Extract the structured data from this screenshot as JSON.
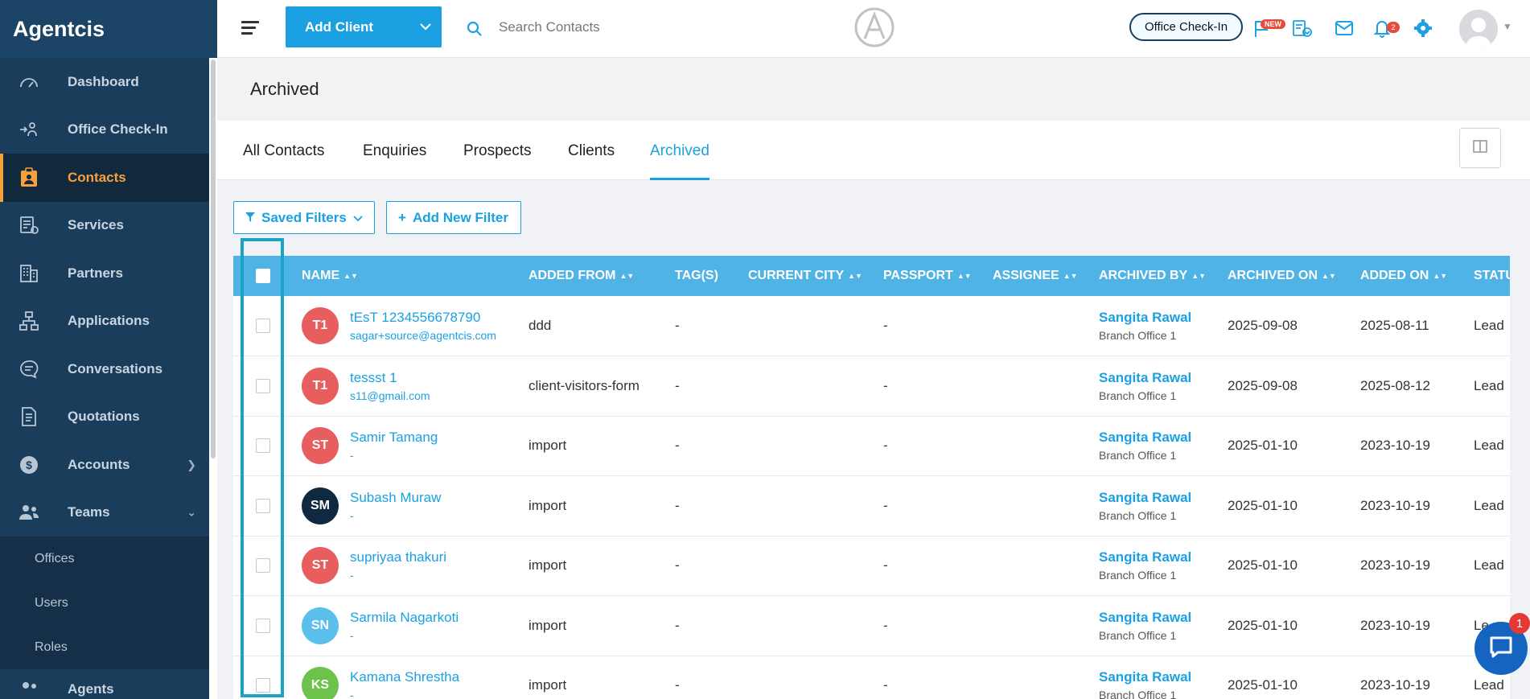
{
  "app": {
    "brand": "Agentcis"
  },
  "sidebar": {
    "items": [
      {
        "label": "Dashboard",
        "icon": "gauge-icon"
      },
      {
        "label": "Office Check-In",
        "icon": "checkin-icon"
      },
      {
        "label": "Contacts",
        "icon": "contact-card-icon",
        "active": true
      },
      {
        "label": "Services",
        "icon": "services-icon"
      },
      {
        "label": "Partners",
        "icon": "building-icon"
      },
      {
        "label": "Applications",
        "icon": "flow-icon"
      },
      {
        "label": "Conversations",
        "icon": "chat-icon"
      },
      {
        "label": "Quotations",
        "icon": "document-icon"
      },
      {
        "label": "Accounts",
        "icon": "dollar-icon"
      },
      {
        "label": "Teams",
        "icon": "team-icon"
      }
    ],
    "teams_sub": [
      "Offices",
      "Users",
      "Roles"
    ],
    "partial": "Agents"
  },
  "topbar": {
    "add_client": "Add Client",
    "search_placeholder": "Search Contacts",
    "office_checkin": "Office Check-In",
    "new_badge": "NEW",
    "notification_count": "2"
  },
  "page": {
    "title": "Archived"
  },
  "tabs": [
    "All Contacts",
    "Enquiries",
    "Prospects",
    "Clients",
    "Archived"
  ],
  "filters": {
    "saved": "Saved Filters",
    "add_new": "Add New Filter"
  },
  "table": {
    "columns": [
      "NAME",
      "ADDED FROM",
      "TAG(S)",
      "CURRENT CITY",
      "PASSPORT",
      "ASSIGNEE",
      "ARCHIVED BY",
      "ARCHIVED ON",
      "ADDED ON",
      "STATUS"
    ],
    "rows": [
      {
        "initials": "T1",
        "color": "#e85d5d",
        "name": "tEsT 1234556678790",
        "email": "sagar+source@agentcis.com",
        "added_from": "ddd",
        "tags": "-",
        "city": "",
        "passport": "-",
        "assignee": "",
        "archived_by": "Sangita Rawal",
        "archived_office": "Branch Office 1",
        "archived_on": "2025-09-08",
        "added_on": "2025-08-11",
        "status": "Lead"
      },
      {
        "initials": "T1",
        "color": "#e85d5d",
        "name": "tessst 1",
        "email": "s11@gmail.com",
        "added_from": "client-visitors-form",
        "tags": "-",
        "city": "",
        "passport": "-",
        "assignee": "",
        "archived_by": "Sangita Rawal",
        "archived_office": "Branch Office 1",
        "archived_on": "2025-09-08",
        "added_on": "2025-08-12",
        "status": "Lead"
      },
      {
        "initials": "ST",
        "color": "#e85d5d",
        "name": "Samir Tamang",
        "email": "-",
        "added_from": "import",
        "tags": "-",
        "city": "",
        "passport": "-",
        "assignee": "",
        "archived_by": "Sangita Rawal",
        "archived_office": "Branch Office 1",
        "archived_on": "2025-01-10",
        "added_on": "2023-10-19",
        "status": "Lead"
      },
      {
        "initials": "SM",
        "color": "#0f2a40",
        "name": "Subash Muraw",
        "email": "-",
        "added_from": "import",
        "tags": "-",
        "city": "",
        "passport": "-",
        "assignee": "",
        "archived_by": "Sangita Rawal",
        "archived_office": "Branch Office 1",
        "archived_on": "2025-01-10",
        "added_on": "2023-10-19",
        "status": "Lead"
      },
      {
        "initials": "ST",
        "color": "#e85d5d",
        "name": "supriyaa thakuri",
        "email": "-",
        "added_from": "import",
        "tags": "-",
        "city": "",
        "passport": "-",
        "assignee": "",
        "archived_by": "Sangita Rawal",
        "archived_office": "Branch Office 1",
        "archived_on": "2025-01-10",
        "added_on": "2023-10-19",
        "status": "Lead"
      },
      {
        "initials": "SN",
        "color": "#5bbfec",
        "name": "Sarmila Nagarkoti",
        "email": "-",
        "added_from": "import",
        "tags": "-",
        "city": "",
        "passport": "-",
        "assignee": "",
        "archived_by": "Sangita Rawal",
        "archived_office": "Branch Office 1",
        "archived_on": "2025-01-10",
        "added_on": "2023-10-19",
        "status": "Le"
      },
      {
        "initials": "KS",
        "color": "#6cc24a",
        "name": "Kamana Shrestha",
        "email": "-",
        "added_from": "import",
        "tags": "-",
        "city": "",
        "passport": "-",
        "assignee": "",
        "archived_by": "Sangita Rawal",
        "archived_office": "Branch Office 1",
        "archived_on": "2025-01-10",
        "added_on": "2023-10-19",
        "status": "Lead"
      }
    ]
  },
  "chat": {
    "badge": "1"
  },
  "colors": {
    "sidebar": "#1a3d5c",
    "accent": "#1ba0e2",
    "active": "#f5a23a",
    "table_header": "#4fb3e6"
  }
}
